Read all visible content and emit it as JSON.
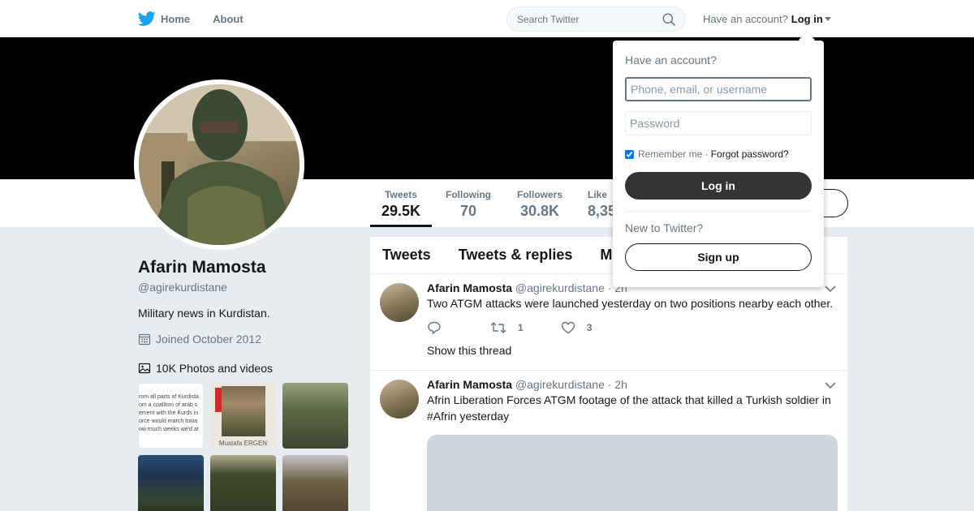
{
  "nav": {
    "home": "Home",
    "about": "About",
    "search_placeholder": "Search Twitter",
    "account_prompt": "Have an account?",
    "login": "Log in"
  },
  "profile": {
    "name": "Afarin Mamosta",
    "handle": "@agirekurdistane",
    "bio": "Military news in Kurdistan.",
    "joined": "Joined October 2012",
    "photos_label": "10K Photos and videos"
  },
  "stats": [
    {
      "label": "Tweets",
      "value": "29.5K"
    },
    {
      "label": "Following",
      "value": "70"
    },
    {
      "label": "Followers",
      "value": "30.8K"
    },
    {
      "label": "Like",
      "value": "8,35"
    }
  ],
  "thumbs": {
    "t1_lines": [
      "rom all parts of Kurdista",
      "om a coalition of arab s",
      "ement with the Kurds in",
      "orce would march towa",
      "ow much weeks we'd ar"
    ],
    "t2_caption": "Mustafa ERGEN"
  },
  "tabs": [
    "Tweets",
    "Tweets & replies",
    "M"
  ],
  "tweets": [
    {
      "name": "Afarin Mamosta",
      "handle": "@agirekurdistane",
      "time": "· 2h",
      "text": "Two ATGM attacks were launched yesterday on two positions nearby each other.",
      "retweets": "1",
      "likes": "3",
      "thread": "Show this thread"
    },
    {
      "name": "Afarin Mamosta",
      "handle": "@agirekurdistane",
      "time": "· 2h",
      "text": "Afrin Liberation Forces ATGM footage of the attack that killed a Turkish soldier in #Afrin yesterday"
    }
  ],
  "dropdown": {
    "title": "Have an account?",
    "username_placeholder": "Phone, email, or username",
    "password_placeholder": "Password",
    "remember": "Remember me ·",
    "forgot": "Forgot password?",
    "login_button": "Log in",
    "new_prompt": "New to Twitter?",
    "signup_button": "Sign up"
  },
  "colors": {
    "brand_blue": "#1da1f2",
    "dark_button": "#343434",
    "muted_text": "#657786"
  }
}
